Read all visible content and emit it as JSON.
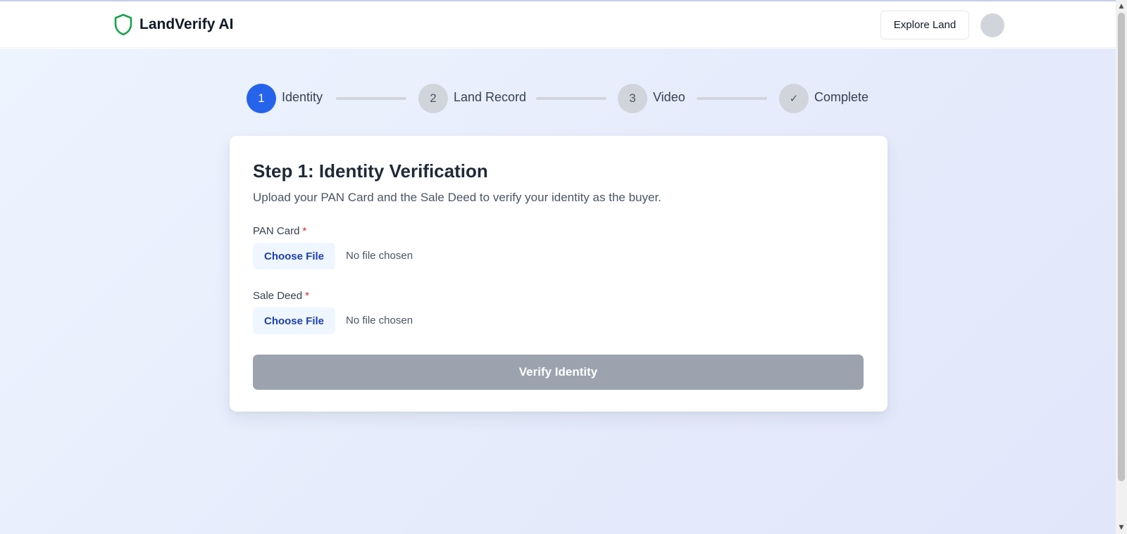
{
  "brand": {
    "name": "LandVerify AI",
    "logo_icon": "shield-icon",
    "accent_color": "#16a34a"
  },
  "header": {
    "explore_label": "Explore Land"
  },
  "stepper": {
    "steps": [
      {
        "number": "1",
        "label": "Identity",
        "status": "active"
      },
      {
        "number": "2",
        "label": "Land Record",
        "status": "pending"
      },
      {
        "number": "3",
        "label": "Video",
        "status": "pending"
      },
      {
        "number": "✓",
        "label": "Complete",
        "status": "pending"
      }
    ],
    "active_color": "#2563eb",
    "pending_color": "#d1d5db"
  },
  "card": {
    "title": "Step 1: Identity Verification",
    "description": "Upload your PAN Card and the Sale Deed to verify your identity as the buyer.",
    "fields": [
      {
        "label": "PAN Card",
        "required_mark": "*",
        "button_label": "Choose File",
        "status": "No file chosen"
      },
      {
        "label": "Sale Deed",
        "required_mark": "*",
        "button_label": "Choose File",
        "status": "No file chosen"
      }
    ],
    "submit_label": "Verify Identity",
    "submit_disabled": true
  }
}
